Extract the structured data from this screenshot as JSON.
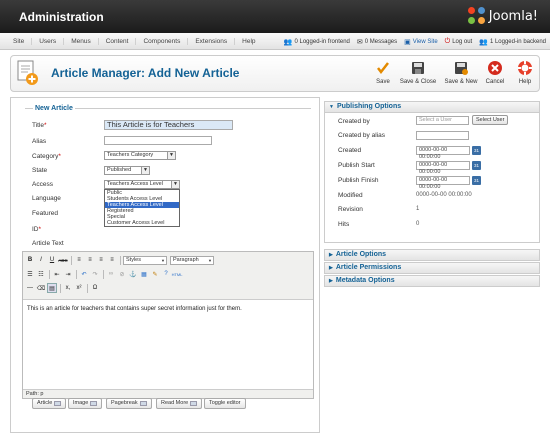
{
  "header": {
    "title": "Administration",
    "logo_text": "Joomla!"
  },
  "menu": [
    "Site",
    "Users",
    "Menus",
    "Content",
    "Components",
    "Extensions",
    "Help"
  ],
  "status": {
    "frontend": "0 Logged-in frontend",
    "messages": "0 Messages",
    "view_site": "View Site",
    "logout": "Log out",
    "backend": "1 Logged-in backend"
  },
  "toolbar": {
    "page_title": "Article Manager: Add New Article",
    "save": "Save",
    "save_close": "Save & Close",
    "save_new": "Save & New",
    "cancel": "Cancel",
    "help": "Help"
  },
  "form": {
    "legend": "New Article",
    "title_label": "Title",
    "title_value": "This Article is for Teachers",
    "alias_label": "Alias",
    "alias_value": "",
    "category_label": "Category",
    "category_value": "Teachers Category",
    "state_label": "State",
    "state_value": "Published",
    "access_label": "Access",
    "access_value": "Teachers Access Level",
    "access_options": [
      "Public",
      "Students Access Level",
      "Teachers Access Level",
      "Registered",
      "Special",
      "Customer Access Level"
    ],
    "language_label": "Language",
    "featured_label": "Featured",
    "id_label": "ID",
    "article_text_label": "Article Text",
    "required_mark": "*"
  },
  "editor": {
    "styles": "Styles",
    "paragraph": "Paragraph",
    "content": "This is an article for teachers that contains super secret information just for them.",
    "path": "Path: p",
    "buttons": [
      "Article",
      "Image",
      "Pagebreak",
      "Read More",
      "Toggle editor"
    ]
  },
  "publishing": {
    "heading": "Publishing Options",
    "created_by_label": "Created by",
    "created_by_placeholder": "Select a User",
    "select_user_button": "Select User",
    "created_by_alias_label": "Created by alias",
    "created_label": "Created",
    "created_value": "0000-00-00 00:00:00",
    "publish_start_label": "Publish Start",
    "publish_start_value": "0000-00-00 00:00:00",
    "publish_finish_label": "Publish Finish",
    "publish_finish_value": "0000-00-00 00:00:00",
    "modified_label": "Modified",
    "modified_value": "0000-00-00 00:00:00",
    "revision_label": "Revision",
    "revision_value": "1",
    "hits_label": "Hits",
    "hits_value": "0",
    "calendar_label": "31"
  },
  "panels": [
    "Article Options",
    "Article Permissions",
    "Metadata Options"
  ],
  "colors": {
    "accent": "#146295",
    "header_bg": "#1b1b1b",
    "highlight": "#3169c6"
  }
}
